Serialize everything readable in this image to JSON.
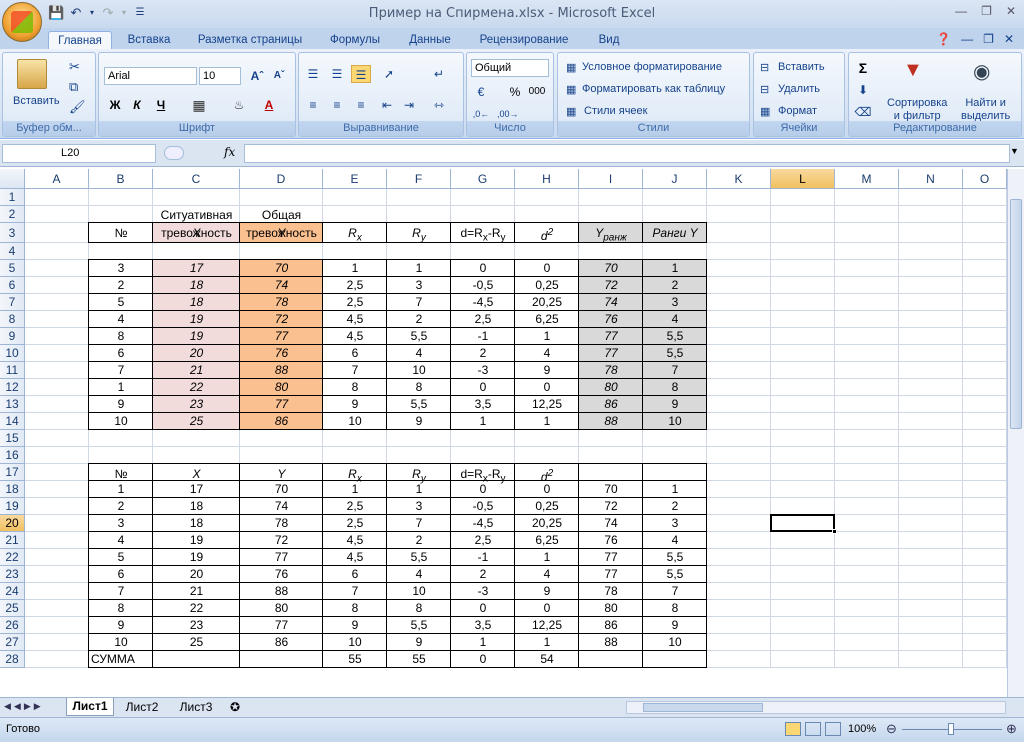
{
  "window": {
    "title": "Пример на Спирмена.xlsx - Microsoft Excel"
  },
  "tabs": [
    "Главная",
    "Вставка",
    "Разметка страницы",
    "Формулы",
    "Данные",
    "Рецензирование",
    "Вид"
  ],
  "ribbon": {
    "clipboard": {
      "paste": "Вставить",
      "label": "Буфер обм..."
    },
    "font": {
      "name": "Arial",
      "size": "10",
      "bold": "Ж",
      "italic": "К",
      "underline": "Ч",
      "label": "Шрифт",
      "color": "A"
    },
    "alignment": {
      "label": "Выравнивание"
    },
    "number": {
      "format": "Общий",
      "percent": "%",
      "thousands": "000",
      "label": "Число"
    },
    "styles": {
      "conditional": "Условное форматирование",
      "table": "Форматировать как таблицу",
      "cell_styles": "Стили ячеек",
      "label": "Стили"
    },
    "cells": {
      "insert": "Вставить",
      "delete": "Удалить",
      "format": "Формат",
      "label": "Ячейки"
    },
    "editing": {
      "sum": "Σ",
      "sort_line1": "Сортировка",
      "sort_line2": "и фильтр",
      "find_line1": "Найти и",
      "find_line2": "выделить",
      "label": "Редактирование"
    }
  },
  "formula_bar": {
    "name_box": "L20",
    "fx": "fx",
    "value": ""
  },
  "columns": [
    "A",
    "B",
    "C",
    "D",
    "E",
    "F",
    "G",
    "H",
    "I",
    "J",
    "K",
    "L",
    "M",
    "N",
    "O"
  ],
  "rows": [
    "1",
    "2",
    "3",
    "4",
    "5",
    "6",
    "7",
    "8",
    "9",
    "10",
    "11",
    "12",
    "13",
    "14",
    "15",
    "16",
    "17",
    "18",
    "19",
    "20",
    "21",
    "22",
    "23",
    "24",
    "25",
    "26",
    "27",
    "28"
  ],
  "table1": {
    "header_c2a": "Ситуативная",
    "header_c2b": "тревожность",
    "header_d2a": "Общая",
    "header_d2b": "тревожность",
    "headers": [
      "№",
      "X",
      "Y",
      "R",
      "R",
      "d=R",
      "-R",
      "d",
      "Y",
      "Ранги Y"
    ],
    "sub": {
      "x": "x",
      "y": "y",
      "rank": "ранж",
      "pow": "2"
    },
    "data": [
      [
        "3",
        "17",
        "70",
        "1",
        "1",
        "0",
        "0",
        "70",
        "1"
      ],
      [
        "2",
        "18",
        "74",
        "2,5",
        "3",
        "-0,5",
        "0,25",
        "72",
        "2"
      ],
      [
        "5",
        "18",
        "78",
        "2,5",
        "7",
        "-4,5",
        "20,25",
        "74",
        "3"
      ],
      [
        "4",
        "19",
        "72",
        "4,5",
        "2",
        "2,5",
        "6,25",
        "76",
        "4"
      ],
      [
        "8",
        "19",
        "77",
        "4,5",
        "5,5",
        "-1",
        "1",
        "77",
        "5,5"
      ],
      [
        "6",
        "20",
        "76",
        "6",
        "4",
        "2",
        "4",
        "77",
        "5,5"
      ],
      [
        "7",
        "21",
        "88",
        "7",
        "10",
        "-3",
        "9",
        "78",
        "7"
      ],
      [
        "1",
        "22",
        "80",
        "8",
        "8",
        "0",
        "0",
        "80",
        "8"
      ],
      [
        "9",
        "23",
        "77",
        "9",
        "5,5",
        "3,5",
        "12,25",
        "86",
        "9"
      ],
      [
        "10",
        "25",
        "86",
        "10",
        "9",
        "1",
        "1",
        "88",
        "10"
      ]
    ]
  },
  "table2": {
    "headers": [
      "№",
      "X",
      "Y",
      "R",
      "R",
      "d=R",
      "-R",
      "d"
    ],
    "data": [
      [
        "1",
        "17",
        "70",
        "1",
        "1",
        "0",
        "0",
        "70",
        "1"
      ],
      [
        "2",
        "18",
        "74",
        "2,5",
        "3",
        "-0,5",
        "0,25",
        "72",
        "2"
      ],
      [
        "3",
        "18",
        "78",
        "2,5",
        "7",
        "-4,5",
        "20,25",
        "74",
        "3"
      ],
      [
        "4",
        "19",
        "72",
        "4,5",
        "2",
        "2,5",
        "6,25",
        "76",
        "4"
      ],
      [
        "5",
        "19",
        "77",
        "4,5",
        "5,5",
        "-1",
        "1",
        "77",
        "5,5"
      ],
      [
        "6",
        "20",
        "76",
        "6",
        "4",
        "2",
        "4",
        "77",
        "5,5"
      ],
      [
        "7",
        "21",
        "88",
        "7",
        "10",
        "-3",
        "9",
        "78",
        "7"
      ],
      [
        "8",
        "22",
        "80",
        "8",
        "8",
        "0",
        "0",
        "80",
        "8"
      ],
      [
        "9",
        "23",
        "77",
        "9",
        "5,5",
        "3,5",
        "12,25",
        "86",
        "9"
      ],
      [
        "10",
        "25",
        "86",
        "10",
        "9",
        "1",
        "1",
        "88",
        "10"
      ]
    ],
    "sum_label": "СУММА",
    "sum_e": "55",
    "sum_f": "55",
    "sum_g": "0",
    "sum_h": "54"
  },
  "sheets": [
    "Лист1",
    "Лист2",
    "Лист3"
  ],
  "status": {
    "ready": "Готово",
    "zoom": "100%"
  },
  "colors": {
    "pink": "#f2dcdb",
    "orange": "#fac090",
    "gray": "#d9d9d9",
    "selection_header": "#f1c15f"
  }
}
